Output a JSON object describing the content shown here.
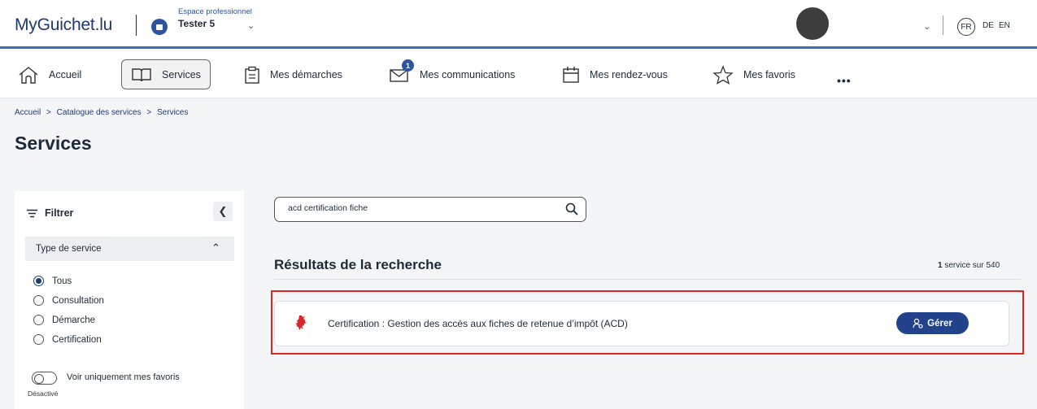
{
  "header": {
    "logo": "MyGuichet.lu",
    "space_label": "Espace professionnel",
    "user_name": "Tester 5",
    "languages": [
      "FR",
      "DE",
      "EN"
    ]
  },
  "nav": {
    "items": [
      "Accueil",
      "Services",
      "Mes démarches",
      "Mes communications",
      "Mes rendez-vous",
      "Mes favoris"
    ],
    "more": "•••",
    "communications_badge": "1",
    "active": "Services"
  },
  "breadcrumb": [
    "Accueil",
    ">",
    "Catalogue des services",
    ">",
    "Services"
  ],
  "page_title": "Services",
  "filter": {
    "title": "Filtrer",
    "section_title": "Type de service",
    "options": [
      "Tous",
      "Consultation",
      "Démarche",
      "Certification"
    ],
    "selected": "Tous",
    "favorites_toggle_label": "Voir uniquement mes favoris",
    "favorites_toggle_state": "Désactivé"
  },
  "search": {
    "value": "acd certification fiche"
  },
  "results": {
    "title": "Résultats de la recherche",
    "count_number": "1",
    "count_suffix": " service sur 540",
    "items": [
      {
        "label": "Certification : Gestion des accès aux fiches de retenue d’impôt (ACD)",
        "action": "Gérer"
      }
    ]
  },
  "colors": {
    "brand_blue": "#22438c",
    "highlight_red": "#e0241f",
    "lion_red": "#d9262c"
  }
}
